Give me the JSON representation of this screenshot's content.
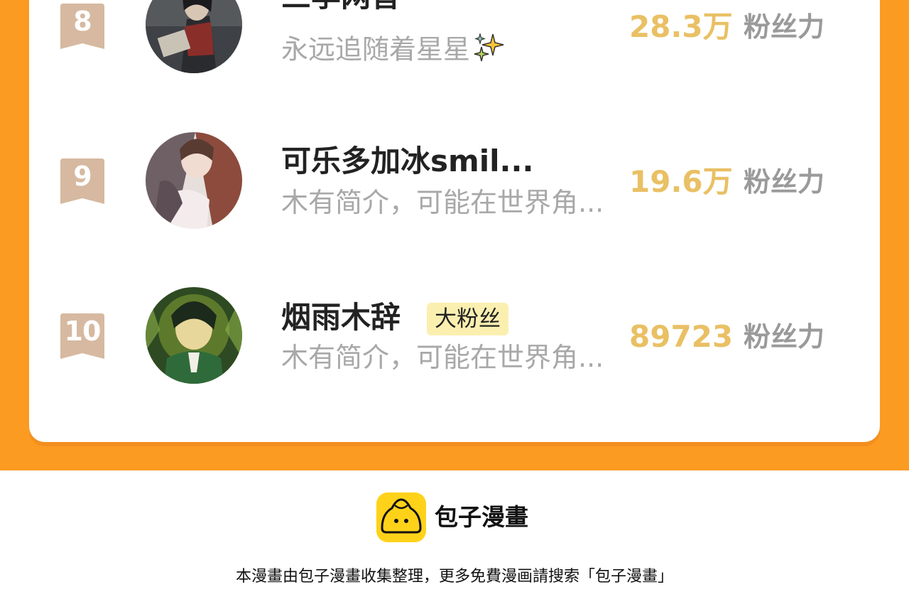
{
  "ranking": {
    "rows": [
      {
        "rank": "8",
        "name": "三李网音",
        "badge": "",
        "bio": "永远追随着星星",
        "fans_value": "28.3万",
        "fans_label": "粉丝力",
        "bio_icon": "sparkles-icon"
      },
      {
        "rank": "9",
        "name": "可乐多加冰smil...",
        "badge": "",
        "bio": "木有简介，可能在世界角...",
        "fans_value": "19.6万",
        "fans_label": "粉丝力"
      },
      {
        "rank": "10",
        "name": "烟雨木辞",
        "badge": "大粉丝",
        "bio": "木有简介，可能在世界角...",
        "fans_value": "89723",
        "fans_label": "粉丝力"
      }
    ]
  },
  "footer": {
    "brand": "包子漫畫",
    "notice": "本漫畫由包子漫畫收集整理，更多免費漫画請搜索「包子漫畫」",
    "logo_icon": "baozi-icon"
  },
  "colors": {
    "background_orange": "#fb9b22",
    "rank_badge": "#d6b9a0",
    "fans_value": "#e9c064",
    "badge_bg": "#fbefb0",
    "logo_yellow": "#ffd21a"
  }
}
